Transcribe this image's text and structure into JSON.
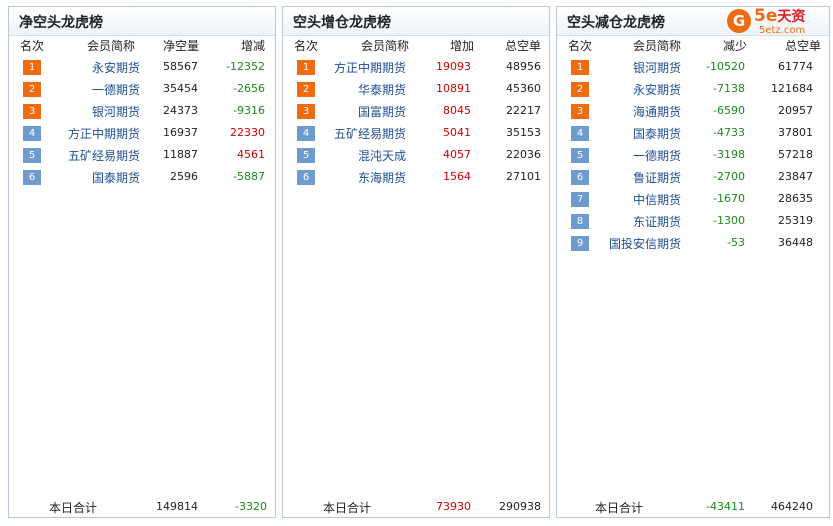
{
  "panels": [
    {
      "title": "净空头龙虎榜",
      "headers": [
        "名次",
        "会员简称",
        "净空量",
        "增减"
      ],
      "rows": [
        {
          "rank": "1",
          "name": "永安期货",
          "v1": "58567",
          "v2": "-12352",
          "v2_color": "neg"
        },
        {
          "rank": "2",
          "name": "一德期货",
          "v1": "35454",
          "v2": "-2656",
          "v2_color": "neg"
        },
        {
          "rank": "3",
          "name": "银河期货",
          "v1": "24373",
          "v2": "-9316",
          "v2_color": "neg"
        },
        {
          "rank": "4",
          "name": "方正中期期货",
          "v1": "16937",
          "v2": "22330",
          "v2_color": "pos"
        },
        {
          "rank": "5",
          "name": "五矿经易期货",
          "v1": "11887",
          "v2": "4561",
          "v2_color": "pos"
        },
        {
          "rank": "6",
          "name": "国泰期货",
          "v1": "2596",
          "v2": "-5887",
          "v2_color": "neg"
        }
      ],
      "total": {
        "label": "本日合计",
        "v1": "149814",
        "v2": "-3320",
        "v2_color": "neg"
      }
    },
    {
      "title": "空头增仓龙虎榜",
      "headers": [
        "名次",
        "会员简称",
        "增加",
        "总空单"
      ],
      "rows": [
        {
          "rank": "1",
          "name": "方正中期期货",
          "v1": "19093",
          "v2": "48956",
          "v1_color": "pos"
        },
        {
          "rank": "2",
          "name": "华泰期货",
          "v1": "10891",
          "v2": "45360",
          "v1_color": "pos"
        },
        {
          "rank": "3",
          "name": "国富期货",
          "v1": "8045",
          "v2": "22217",
          "v1_color": "pos"
        },
        {
          "rank": "4",
          "name": "五矿经易期货",
          "v1": "5041",
          "v2": "35153",
          "v1_color": "pos"
        },
        {
          "rank": "5",
          "name": "混沌天成",
          "v1": "4057",
          "v2": "22036",
          "v1_color": "pos"
        },
        {
          "rank": "6",
          "name": "东海期货",
          "v1": "1564",
          "v2": "27101",
          "v1_color": "pos"
        }
      ],
      "total": {
        "label": "本日合计",
        "v1": "73930",
        "v2": "290938",
        "v1_color": "pos"
      }
    },
    {
      "title": "空头减仓龙虎榜",
      "headers": [
        "名次",
        "会员简称",
        "减少",
        "总空单"
      ],
      "rows": [
        {
          "rank": "1",
          "name": "银河期货",
          "v1": "-10520",
          "v2": "61774",
          "v1_color": "neg"
        },
        {
          "rank": "2",
          "name": "永安期货",
          "v1": "-7138",
          "v2": "121684",
          "v1_color": "neg"
        },
        {
          "rank": "3",
          "name": "海通期货",
          "v1": "-6590",
          "v2": "20957",
          "v1_color": "neg"
        },
        {
          "rank": "4",
          "name": "国泰期货",
          "v1": "-4733",
          "v2": "37801",
          "v1_color": "neg"
        },
        {
          "rank": "5",
          "name": "一德期货",
          "v1": "-3198",
          "v2": "57218",
          "v1_color": "neg"
        },
        {
          "rank": "6",
          "name": "鲁证期货",
          "v1": "-2700",
          "v2": "23847",
          "v1_color": "neg"
        },
        {
          "rank": "7",
          "name": "中信期货",
          "v1": "-1670",
          "v2": "28635",
          "v1_color": "neg"
        },
        {
          "rank": "8",
          "name": "东证期货",
          "v1": "-1300",
          "v2": "25319",
          "v1_color": "neg"
        },
        {
          "rank": "9",
          "name": "国投安信期货",
          "v1": "-53",
          "v2": "36448",
          "v1_color": "neg"
        }
      ],
      "total": {
        "label": "本日合计",
        "v1": "-43411",
        "v2": "464240",
        "v1_color": "neg"
      }
    }
  ],
  "logo": {
    "brand": "5e",
    "brand_cn": "天资",
    "url": "5etz.com"
  },
  "colors": {
    "rank_top": "#f06a0f",
    "rank_rest": "#6e9ccf",
    "negative": "#1a8a1a",
    "positive": "#d40000",
    "name": "#1f4f94"
  }
}
